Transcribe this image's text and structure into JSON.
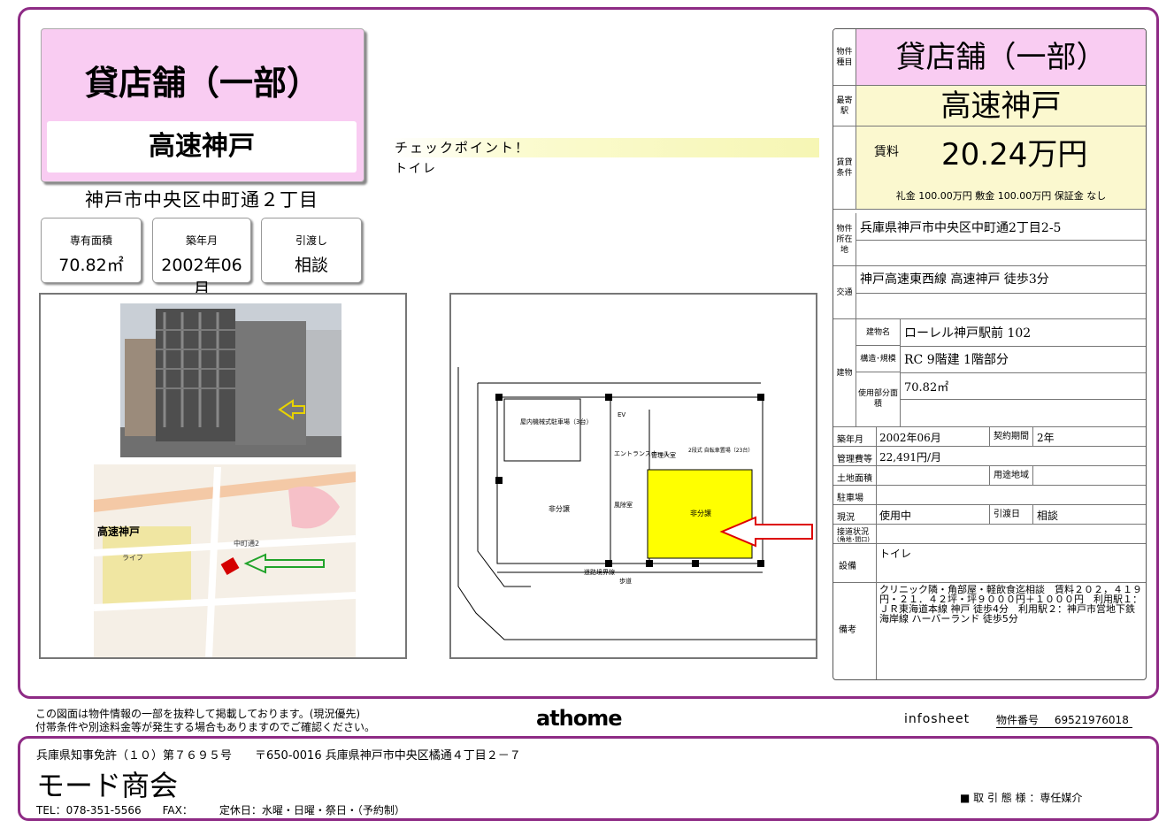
{
  "property": {
    "type": "貸店舗（一部）",
    "station": "高速神戸",
    "address_short": "神戸市中央区中町通２丁目",
    "area": {
      "label": "専有面積",
      "value": "70.82㎡"
    },
    "built": {
      "label": "築年月",
      "value": "2002年06月"
    },
    "handover": {
      "label": "引渡し",
      "value": "相談"
    }
  },
  "checkpoint": {
    "title": "チェックポイント！",
    "item": "トイレ"
  },
  "map_labels": {
    "station": "高速神戸",
    "life": "ライフ",
    "street": "中町通2"
  },
  "plan_labels": {
    "shop": "非分譲",
    "target": "非分譲",
    "entrance": "エントランスホール",
    "ev": "EV",
    "parking": "屋内機械式駐車場（3台）",
    "manager": "管理人室",
    "bike": "2段式 自転車置場（23台）",
    "wind": "風除室",
    "sidewalk": "歩道",
    "road": "道路境界線"
  },
  "table": {
    "labels": {
      "type": "物件種目",
      "station": "最寄駅",
      "rent": "賃貸条件",
      "location": "物件所在地",
      "transport": "交通",
      "building": "建物",
      "bname": "建物名",
      "structure": "構造･規模",
      "usage_area": "使用部分面積",
      "built": "築年月",
      "contract": "契約期間",
      "mgmt": "管理費等",
      "land": "土地面積",
      "zone": "用途地域",
      "parking": "駐車場",
      "status": "現況",
      "handover": "引渡日",
      "road": "接道状況",
      "road_sub": "(角地･間口)",
      "equip": "設備",
      "remarks": "備考",
      "rent_label": "賃料"
    },
    "type": "貸店舗（一部）",
    "station": "高速神戸",
    "rent": "20.24万円",
    "deposits": "礼金 100.00万円  敷金 100.00万円  保証金 なし",
    "location": "兵庫県神戸市中央区中町通2丁目2-5",
    "transport": "神戸高速東西線 高速神戸 徒歩3分",
    "building_name": "ローレル神戸駅前  102",
    "structure": "RC 9階建 1階部分",
    "usage_area": "70.82㎡",
    "built": "2002年06月",
    "contract": "2年",
    "mgmt": "22,491円/月",
    "status": "使用中",
    "handover": "相談",
    "equip": "トイレ",
    "remarks": "クリニック隣・角部屋・軽飲食迄相談　賃料２０２，４１９円・２１．４２坪・坪９０００円＋１０００円　利用駅１：ＪＲ東海道本線 神戸 徒歩4分　利用駅２：神戸市営地下鉄海岸線 ハーバーランド 徒歩5分"
  },
  "footer": {
    "note1": "この図面は物件情報の一部を抜粋して掲載しております。(現況優先)",
    "note2": "付帯条件や別途料金等が発生する場合もありますのでご確認ください。",
    "logo": "athome",
    "infosheet": "infosheet",
    "propno_label": "物件番号",
    "propno": "69521976018",
    "license": "兵庫県知事免許（１０）第７６９５号　　〒650-0016 兵庫県神戸市中央区橘通４丁目２－７",
    "company": "モード商会",
    "tel": "TEL：078-351-5566　　FAX：　　　定休日：水曜・日曜・祭日・（予約制）",
    "deal": "■ 取 引 態 様 ：専任媒介"
  }
}
